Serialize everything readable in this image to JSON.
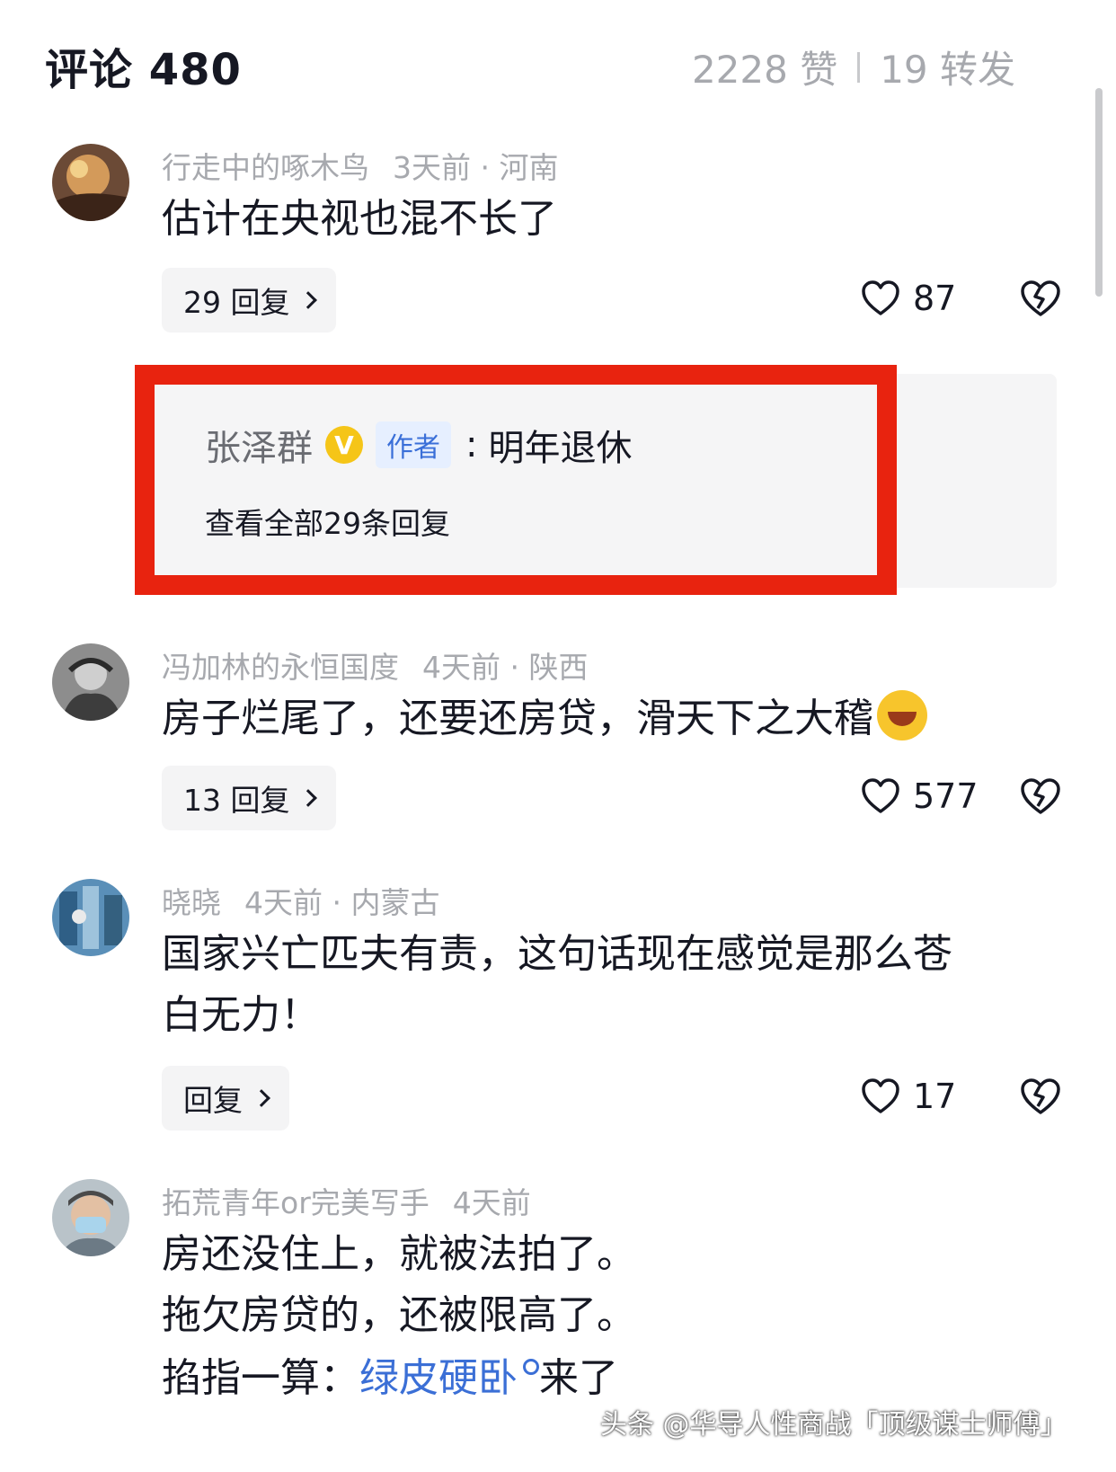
{
  "header": {
    "title": "评论 480",
    "likes": "2228 赞",
    "shares": "19 转发"
  },
  "comments": [
    {
      "username": "行走中的啄木鸟",
      "time_location": "3天前 · 河南",
      "text": "估计在央视也混不长了",
      "reply_label": "29 回复",
      "like_count": "87"
    },
    {
      "username": "冯加林的永恒国度",
      "time_location": "4天前 · 陕西",
      "text": "房子烂尾了，还要还房贷，滑天下之大稽",
      "reply_label": "13 回复",
      "like_count": "577"
    },
    {
      "username": "晓晓",
      "time_location": "4天前 · 内蒙古",
      "text_line1": "国家兴亡匹夫有责，这句话现在感觉是那么苍",
      "text_line2": "白无力！",
      "reply_label": "回复",
      "like_count": "17"
    },
    {
      "username": "拓荒青年or完美写手",
      "time_location": "4天前",
      "text_line1": "房还没住上，就被法拍了。",
      "text_line2": " 拖欠房贷的，还被限高了。",
      "text_line3_prefix": " 掐指一算：",
      "text_line3_link": "绿皮硬卧",
      "text_line3_suffix": "来了"
    }
  ],
  "author_reply": {
    "name": "张泽群",
    "badge": "V",
    "tag": "作者",
    "text": "明年退休",
    "view_all": "查看全部29条回复"
  },
  "watermark": "头条 @华导人性商战「顶级谋士师傅」",
  "colors": {
    "highlight_border": "#e8230f",
    "link": "#3b6fd6",
    "meta_gray": "#a7a9ae"
  }
}
